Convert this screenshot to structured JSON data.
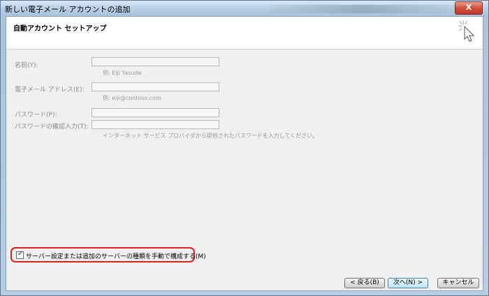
{
  "window": {
    "title": "新しい電子メール アカウントの追加",
    "close_label": "X"
  },
  "header": {
    "title": "自動アカウント セットアップ"
  },
  "form": {
    "name_label": "名前(Y):",
    "name_value": "",
    "name_hint": "例: Eiji Yasuda",
    "email_label": "電子メール アドレス(E):",
    "email_value": "",
    "email_hint": "例: eiji@contoso.com",
    "password_label": "パスワード(P):",
    "password_value": "",
    "password_confirm_label": "パスワードの確認入力(T):",
    "password_confirm_value": "",
    "password_hint": "インターネット サービス プロバイダから提供されたパスワードを入力してください。"
  },
  "manual_setup": {
    "label": "サーバー設定または追加のサーバーの種類を手動で構成する(M)",
    "checked": true,
    "check_glyph": "✓"
  },
  "buttons": {
    "back": "< 戻る(B)",
    "next": "次へ(N) >",
    "cancel": "キャンセル"
  },
  "icons": {
    "wizard": "wizard-sparkle-cursor-icon",
    "checkbox": "checkbox-icon"
  },
  "colors": {
    "highlight_border": "#e02020",
    "primary_button": "#3c7fb1"
  }
}
